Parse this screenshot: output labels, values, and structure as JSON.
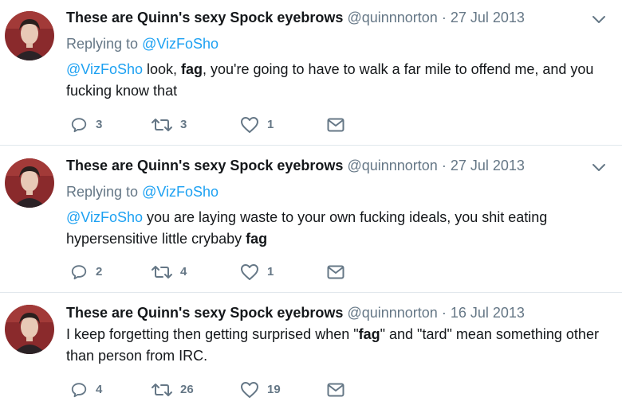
{
  "tweets": [
    {
      "name": "These are Quinn's sexy Spock eyebrows",
      "handle": "@quinnnorton",
      "dot": "·",
      "date": "27 Jul 2013",
      "replying_label": "Replying to",
      "replying_handle": "@VizFoSho",
      "body": [
        {
          "t": "@VizFoSho",
          "s": "mention"
        },
        {
          "t": " look, ",
          "s": "text"
        },
        {
          "t": "fag",
          "s": "bold"
        },
        {
          "t": ", you're going to have to walk a far mile to offend me, and you fucking know that",
          "s": "text"
        }
      ],
      "replies": "3",
      "retweets": "3",
      "likes": "1"
    },
    {
      "name": "These are Quinn's sexy Spock eyebrows",
      "handle": "@quinnnorton",
      "dot": "·",
      "date": "27 Jul 2013",
      "replying_label": "Replying to",
      "replying_handle": "@VizFoSho",
      "body": [
        {
          "t": "@VizFoSho",
          "s": "mention"
        },
        {
          "t": " you are laying waste to your own fucking ideals, you shit eating hypersensitive little crybaby ",
          "s": "text"
        },
        {
          "t": "fag",
          "s": "bold"
        }
      ],
      "replies": "2",
      "retweets": "4",
      "likes": "1"
    },
    {
      "name": "These are Quinn's sexy Spock eyebrows",
      "handle": "@quinnnorton",
      "dot": "·",
      "date": "16 Jul 2013",
      "body": [
        {
          "t": "I keep forgetting then getting surprised when \"",
          "s": "text"
        },
        {
          "t": "fag",
          "s": "bold"
        },
        {
          "t": "\" and \"tard\" mean something other than person from IRC.",
          "s": "text"
        }
      ],
      "replies": "4",
      "retweets": "26",
      "likes": "19"
    }
  ],
  "icons": {
    "reply": "reply-icon",
    "retweet": "retweet-icon",
    "like": "heart-icon",
    "message": "envelope-icon",
    "more": "chevron-down-icon"
  },
  "colors": {
    "name": "#14171a",
    "meta": "#657786",
    "mention": "#1da1f2",
    "divider": "#e1e8ed"
  }
}
